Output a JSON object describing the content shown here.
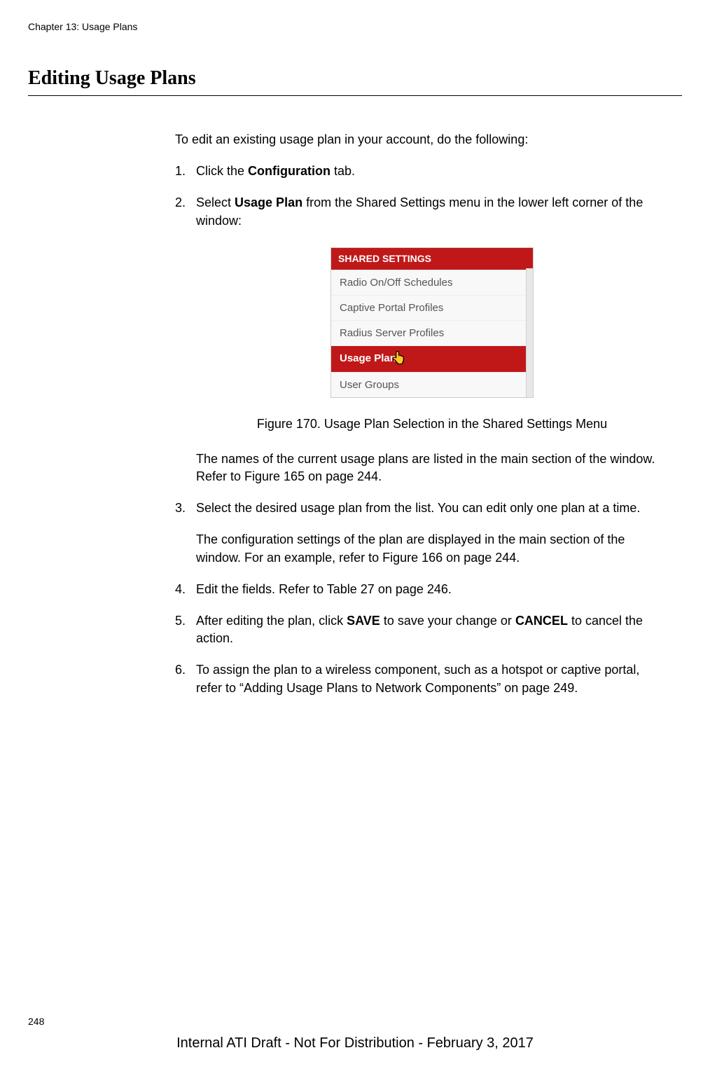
{
  "header": {
    "chapter": "Chapter 13: Usage Plans"
  },
  "section": {
    "title": "Editing Usage Plans"
  },
  "intro": "To edit an existing usage plan in your account, do the following:",
  "steps": {
    "s1": {
      "num": "1.",
      "pre": "Click the ",
      "bold": "Configuration",
      "post": " tab."
    },
    "s2": {
      "num": "2.",
      "pre": "Select ",
      "bold": "Usage Plan",
      "post": " from the Shared Settings menu in the lower left corner of the window:"
    },
    "s2_after": "The names of the current usage plans are listed in the main section of the window. Refer to Figure 165 on page 244.",
    "s3": {
      "num": "3.",
      "text": "Select the desired usage plan from the list. You can edit only one plan at a time.",
      "sub": "The configuration settings of the plan are displayed in the main section of the window. For an example, refer to Figure 166 on page 244."
    },
    "s4": {
      "num": "4.",
      "text": "Edit the fields. Refer to Table 27 on page 246."
    },
    "s5": {
      "num": "5.",
      "pre": "After editing the plan, click ",
      "bold1": "SAVE",
      "mid": " to save your change or ",
      "bold2": "CANCEL",
      "post": " to cancel the action."
    },
    "s6": {
      "num": "6.",
      "text": "To assign the plan to a wireless component, such as a hotspot or captive portal, refer to “Adding Usage Plans to Network Components” on page 249."
    }
  },
  "screenshot": {
    "header": "SHARED SETTINGS",
    "items": {
      "i0": "Radio On/Off Schedules",
      "i1": "Captive Portal Profiles",
      "i2": "Radius Server Profiles",
      "i3": "Usage Plan",
      "i4": "User Groups"
    }
  },
  "figure_caption": "Figure 170. Usage Plan Selection in the Shared Settings Menu",
  "page_number": "248",
  "footer": "Internal ATI Draft - Not For Distribution - February 3, 2017"
}
